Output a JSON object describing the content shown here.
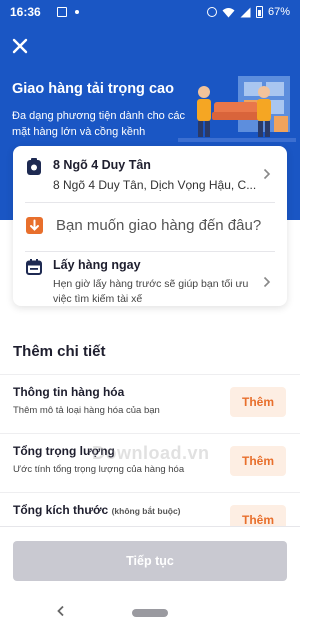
{
  "status_bar": {
    "time": "16:36",
    "battery": "67%"
  },
  "header": {
    "title": "Giao hàng tải trọng cao",
    "subtitle": "Đa dạng phương tiện dành cho các mặt hàng lớn và cồng kềnh",
    "background_color": "#1a56c4"
  },
  "pickup": {
    "title": "8 Ngõ 4 Duy Tân",
    "address": "8 Ngõ 4 Duy Tân, Dịch Vọng Hậu, C..."
  },
  "destination": {
    "placeholder": "Bạn muốn giao hàng đến đâu?"
  },
  "pickup_time": {
    "title": "Lấy hàng ngay",
    "subtitle": "Hẹn giờ lấy hàng trước sẽ giúp bạn tối ưu việc tìm kiếm tài xế"
  },
  "details": {
    "section_title": "Thêm chi tiết",
    "items": [
      {
        "title": "Thông tin hàng hóa",
        "note": "",
        "subtitle": "Thêm mô tả loại hàng hóa của bạn",
        "button": "Thêm"
      },
      {
        "title": "Tổng trọng lượng",
        "note": "",
        "subtitle": "Ước tính tổng trọng lượng của hàng hóa",
        "button": "Thêm"
      },
      {
        "title": "Tổng kích thước",
        "note": "(không bắt buộc)",
        "subtitle": "",
        "button": "Thêm"
      }
    ]
  },
  "watermark": "Download.vn",
  "footer": {
    "continue_label": "Tiếp tục"
  },
  "colors": {
    "accent_orange": "#e86f2c",
    "button_disabled": "#c9c9d1"
  }
}
